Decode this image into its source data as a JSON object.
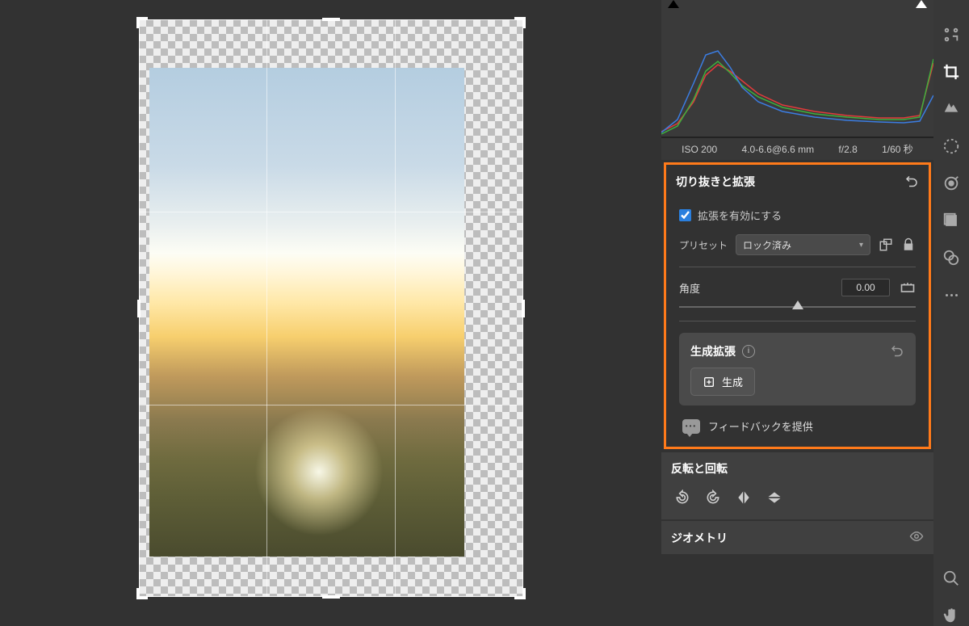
{
  "metadata": {
    "iso": "ISO 200",
    "focal": "4.0-6.6@6.6 mm",
    "aperture": "f/2.8",
    "shutter": "1/60 秒"
  },
  "crop_panel": {
    "title": "切り抜きと拡張",
    "enable_expand_label": "拡張を有効にする",
    "preset_label": "プリセット",
    "preset_value": "ロック済み",
    "angle_label": "角度",
    "angle_value": "0.00"
  },
  "gen_section": {
    "title": "生成拡張",
    "generate_label": "生成"
  },
  "feedback": {
    "label": "フィードバックを提供"
  },
  "flip_section": {
    "title": "反転と回転"
  },
  "geometry_section": {
    "title": "ジオメトリ"
  }
}
